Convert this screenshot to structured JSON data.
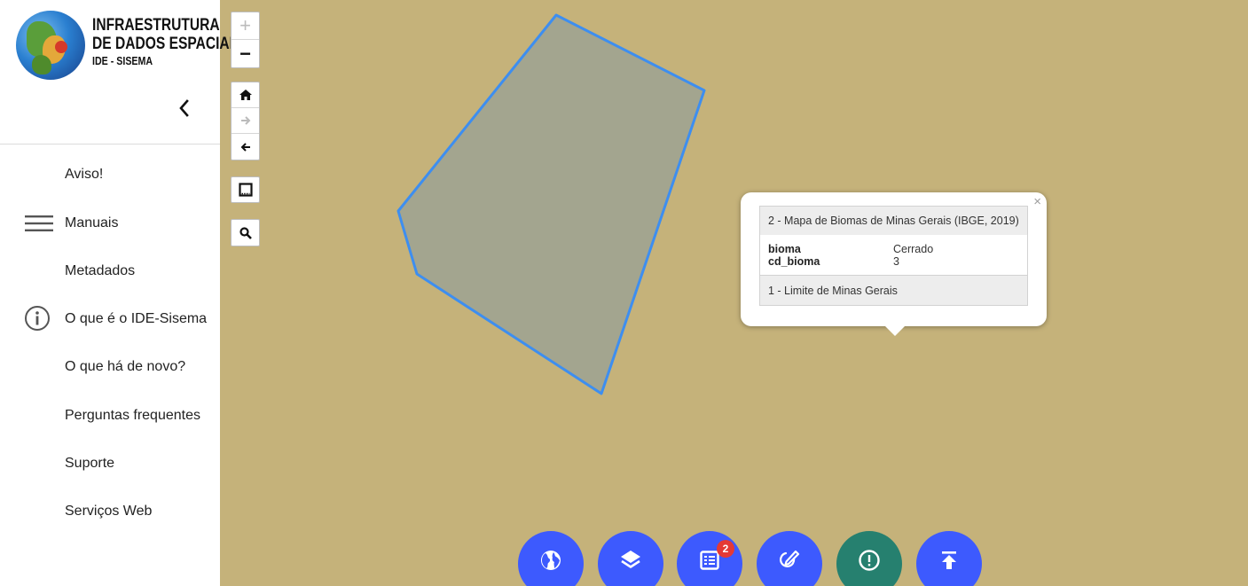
{
  "brand": {
    "line1": "INFRAESTRUTURA",
    "line2": "DE DADOS ESPACIAIS",
    "line3": "IDE - SISEMA"
  },
  "menu": {
    "items": [
      {
        "label": "Aviso!"
      },
      {
        "label": "Manuais"
      },
      {
        "label": "Metadados"
      },
      {
        "label": "O que é o IDE-Sisema"
      },
      {
        "label": "O que há de novo?"
      },
      {
        "label": "Perguntas frequentes"
      },
      {
        "label": "Suporte"
      },
      {
        "label": "Serviços Web"
      }
    ]
  },
  "map": {
    "background_color": "#c5b27a",
    "polygon_fill": "#a3a58f",
    "polygon_stroke": "#3d8ef0",
    "controls": {
      "zoom_in": "+",
      "zoom_out": "−"
    }
  },
  "popup": {
    "close_label": "×",
    "layer1_title": "2 - Mapa de Biomas de Minas Gerais (IBGE, 2019)",
    "attributes": [
      {
        "key": "bioma",
        "value": "Cerrado"
      },
      {
        "key": "cd_bioma",
        "value": "3"
      }
    ],
    "layer2_title": "1 - Limite de Minas Gerais"
  },
  "toolbar": {
    "buttons": [
      {
        "icon": "globe-icon",
        "color": "#3d5afe"
      },
      {
        "icon": "layers-icon",
        "color": "#3d5afe"
      },
      {
        "icon": "list-icon",
        "color": "#3d5afe",
        "badge": "2"
      },
      {
        "icon": "edit-icon",
        "color": "#3d5afe"
      },
      {
        "icon": "alert-icon",
        "color": "#26806f"
      },
      {
        "icon": "upload-icon",
        "color": "#3d5afe"
      }
    ]
  }
}
